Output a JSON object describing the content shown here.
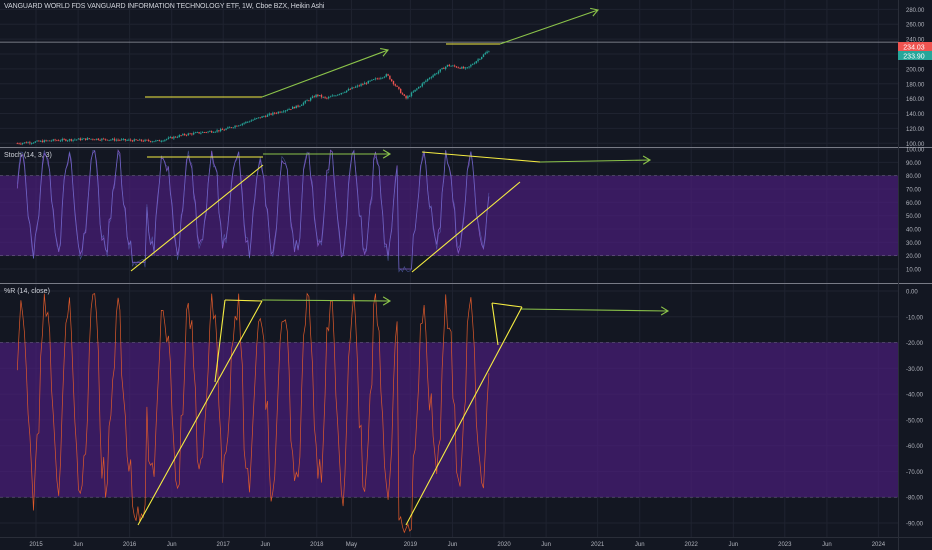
{
  "header": {
    "title": "VANGUARD WORLD FDS VANGUARD INFORMATION TECHNOLOGY ETF, 1W, Cboe BZX, Heikin Ashi"
  },
  "price_pane": {
    "last_price_badge": "234.03",
    "second_badge": "233.90"
  },
  "stoch_pane": {
    "label": "Stoch (14, 3, 3)"
  },
  "wr_pane": {
    "label": "%R (14, close)"
  },
  "colors": {
    "background": "#131722",
    "up_candle": "#26a69a",
    "down_candle": "#ef5350",
    "stoch_band": "#4a1e7a",
    "stoch_line": "#7e57c2",
    "wr_line": "#e05a2b",
    "annotation_yellow": "#f5ec42",
    "annotation_green": "#8bc34a",
    "grid": "#1f2330",
    "axis_text": "#b2b5be"
  },
  "chart_data": [
    {
      "type": "candlestick",
      "title": "VANGUARD WORLD FDS VANGUARD INFORMATION TECHNOLOGY ETF, 1W, Cboe BZX, Heikin Ashi",
      "y_ticks": [
        "280.00",
        "260.00",
        "240.00",
        "220.00",
        "200.00",
        "180.00",
        "160.00",
        "140.00",
        "120.00",
        "100.00"
      ],
      "ylim": [
        95,
        290
      ],
      "x_ticks": [
        "2015",
        "Jun",
        "2016",
        "Jun",
        "2017",
        "Jun",
        "2018",
        "May",
        "2019",
        "Jun",
        "2020",
        "Jun",
        "2021",
        "Jun",
        "2022",
        "Jun",
        "2023",
        "Jun",
        "2024"
      ],
      "xlim": [
        2014.8,
        2024.1
      ],
      "series_close_approx": [
        {
          "x": 2014.8,
          "y": 100
        },
        {
          "x": 2015.2,
          "y": 104
        },
        {
          "x": 2015.6,
          "y": 106
        },
        {
          "x": 2016.0,
          "y": 104
        },
        {
          "x": 2016.3,
          "y": 103
        },
        {
          "x": 2016.6,
          "y": 112
        },
        {
          "x": 2017.0,
          "y": 118
        },
        {
          "x": 2017.4,
          "y": 135
        },
        {
          "x": 2017.8,
          "y": 150
        },
        {
          "x": 2018.0,
          "y": 165
        },
        {
          "x": 2018.1,
          "y": 160
        },
        {
          "x": 2018.5,
          "y": 180
        },
        {
          "x": 2018.75,
          "y": 192
        },
        {
          "x": 2018.95,
          "y": 160
        },
        {
          "x": 2019.2,
          "y": 188
        },
        {
          "x": 2019.4,
          "y": 205
        },
        {
          "x": 2019.6,
          "y": 200
        },
        {
          "x": 2019.85,
          "y": 226
        }
      ],
      "horizontal_line": 236,
      "grid": true
    },
    {
      "type": "line",
      "title": "Stoch (14, 3, 3)",
      "y_ticks": [
        "100.00",
        "90.00",
        "80.00",
        "70.00",
        "60.00",
        "50.00",
        "40.00",
        "30.00",
        "20.00",
        "10.00"
      ],
      "ylim": [
        0,
        100
      ],
      "band": [
        20,
        80
      ],
      "grid": true
    },
    {
      "type": "line",
      "title": "%R (14, close)",
      "y_ticks": [
        "0.00",
        "-10.00",
        "-20.00",
        "-30.00",
        "-40.00",
        "-50.00",
        "-60.00",
        "-70.00",
        "-80.00",
        "-90.00"
      ],
      "ylim": [
        -100,
        0
      ],
      "band": [
        -80,
        -20
      ],
      "grid": true
    }
  ]
}
